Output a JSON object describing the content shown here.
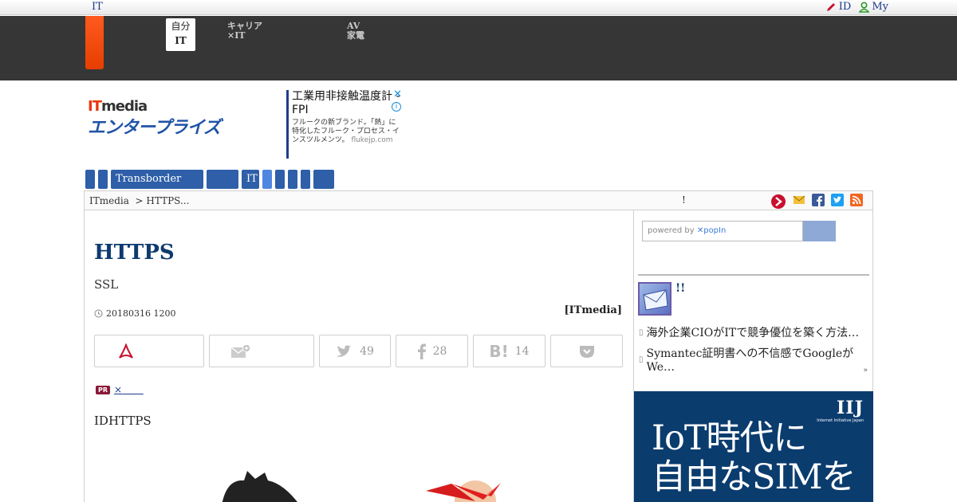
{
  "top_bar": {
    "brand": "IT",
    "links": [
      "ID",
      "My"
    ]
  },
  "band": {
    "items": [
      {
        "line1": "自分",
        "line2": "IT"
      },
      {
        "line1": "キャリア",
        "line2": "×IT"
      },
      {
        "line1": "AV",
        "line2": "家電"
      }
    ]
  },
  "logo": {
    "top": "ITmedia",
    "bottom": "エンタープライズ"
  },
  "ad": {
    "headline": "工業用非接触温度計 - FPI",
    "desc": "フルークの新ブランド。「熱」に特化したフルーク・プロセス・インスツルメンツ。",
    "domain": "flukejp.com",
    "close": "✕",
    "info": "i"
  },
  "categories": [
    "",
    "",
    "Transborder",
    "",
    "IT",
    "",
    "",
    "",
    "",
    ""
  ],
  "breadcrumb": {
    "home": "ITmedia",
    "current": "HTTPS...",
    "middle_mark": "!"
  },
  "article": {
    "title": "HTTPS",
    "subtitle": "SSL",
    "date": "20180316 1200",
    "byline": "[ITmedia]",
    "share": {
      "tw": "49",
      "fb": "28",
      "hb": "14"
    },
    "pr_badge": "PR",
    "pr_text": "×",
    "lead": "IDHTTPS"
  },
  "sidebar": {
    "search_placeholder": "powered by",
    "search_brand": "popIn",
    "headline": "!!",
    "links": [
      "海外企業CIOがITで競争優位を築く方法…",
      "Symantec証明書への不信感でGoogleがWe…"
    ],
    "more": "»",
    "ad": {
      "brand": "IIJ",
      "brand_sub": "Internet Initiative Japan",
      "line1": "IoT時代に",
      "line2": "自由なSIMを"
    }
  },
  "colors": {
    "accent": "#2e5fa8",
    "brand_orange": "#e8380d",
    "dark_band": "#363636"
  }
}
